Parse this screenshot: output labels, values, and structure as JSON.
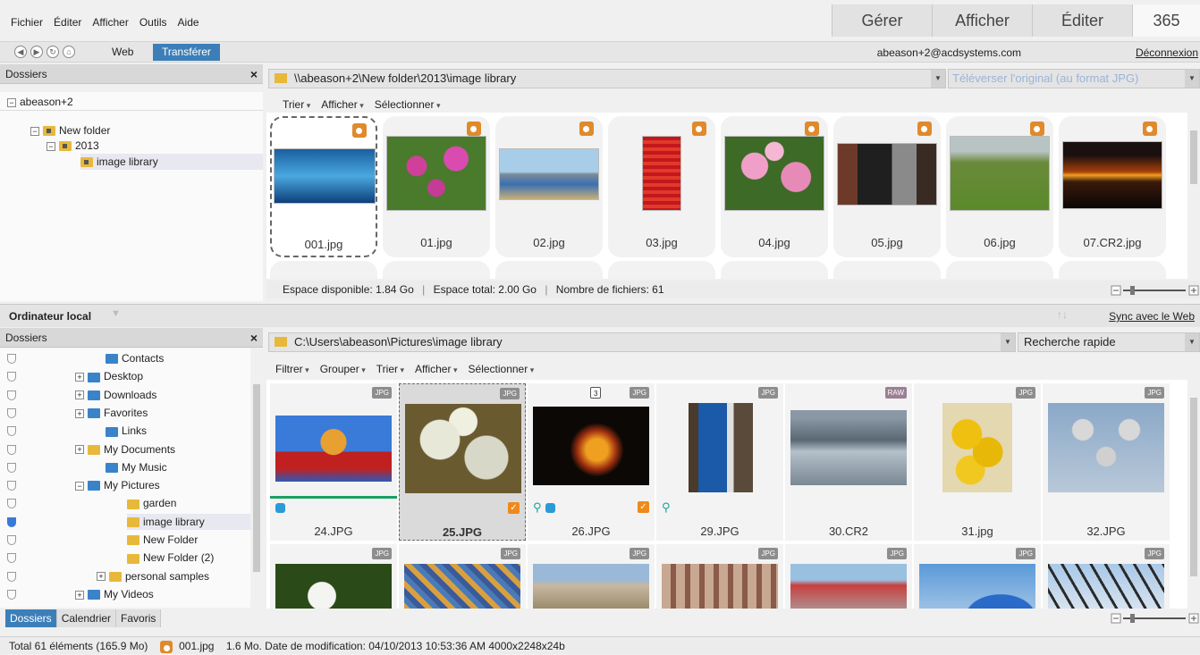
{
  "menu": [
    "Fichier",
    "Éditer",
    "Afficher",
    "Outils",
    "Aide"
  ],
  "modes": [
    "Gérer",
    "Afficher",
    "Éditer",
    "365"
  ],
  "nav": {
    "web_label": "Web",
    "transfer_label": "Transférer",
    "account": "abeason+2@acdsystems.com",
    "logout": "Déconnexion"
  },
  "top": {
    "folders_header": "Dossiers",
    "root": "abeason+2",
    "tree": [
      "New folder",
      "2013",
      "image library"
    ],
    "path": "\\\\abeason+2\\New folder\\2013\\image library",
    "upload_placeholder": "Téléverser l'original (au format JPG)",
    "tools": [
      "Trier",
      "Afficher",
      "Sélectionner"
    ],
    "files": [
      "001.jpg",
      "01.jpg",
      "02.jpg",
      "03.jpg",
      "04.jpg",
      "05.jpg",
      "06.jpg",
      "07.CR2.jpg"
    ],
    "status": {
      "free": "Espace disponible: 1.84 Go",
      "total": "Espace total: 2.00 Go",
      "count": "Nombre de fichiers: 61"
    }
  },
  "local": {
    "title": "Ordinateur local",
    "sync": "Sync avec le Web",
    "folders_header": "Dossiers",
    "tree": [
      "Contacts",
      "Desktop",
      "Downloads",
      "Favorites",
      "Links",
      "My Documents",
      "My Music",
      "My Pictures",
      "garden",
      "image library",
      "New Folder",
      "New Folder (2)",
      "personal samples",
      "My Videos"
    ],
    "tabs": [
      "Dossiers",
      "Calendrier",
      "Favoris"
    ],
    "path": "C:\\Users\\abeason\\Pictures\\image library",
    "search_placeholder": "Recherche rapide",
    "tools": [
      "Filtrer",
      "Grouper",
      "Trier",
      "Afficher",
      "Sélectionner"
    ],
    "files": [
      "24.JPG",
      "25.JPG",
      "26.JPG",
      "29.JPG",
      "30.CR2",
      "31.jpg",
      "32.JPG"
    ],
    "badges": [
      "JPG",
      "JPG",
      "JPG",
      "JPG",
      "RAW",
      "JPG",
      "JPG"
    ],
    "stack_count": "3"
  },
  "statusbar": {
    "total": "Total 61 éléments  (165.9 Mo)",
    "file": "001.jpg",
    "info": "1.6 Mo. Date de modification: 04/10/2013 10:53:36 AM   4000x2248x24b"
  }
}
